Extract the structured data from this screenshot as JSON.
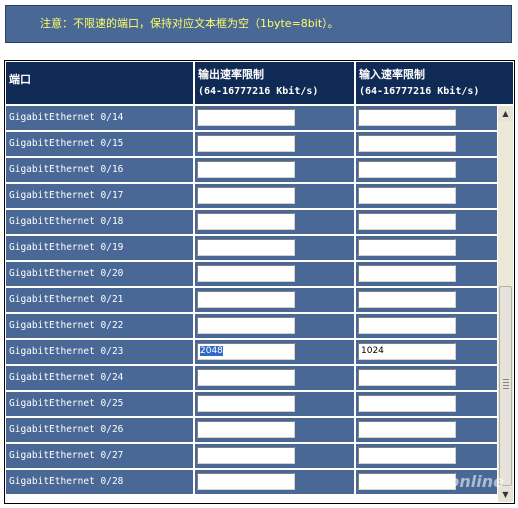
{
  "notice": "注意：不限速的端口，保持对应文本框为空（1byte=8bit）。",
  "columns": {
    "port": "端口",
    "egress_title": "输出速率限制",
    "egress_range": "(64-16777216 Kbit/s)",
    "ingress_title": "输入速率限制",
    "ingress_range": "(64-16777216 Kbit/s)"
  },
  "rows": [
    {
      "port": "GigabitEthernet 0/14",
      "egress": "",
      "ingress": ""
    },
    {
      "port": "GigabitEthernet 0/15",
      "egress": "",
      "ingress": ""
    },
    {
      "port": "GigabitEthernet 0/16",
      "egress": "",
      "ingress": ""
    },
    {
      "port": "GigabitEthernet 0/17",
      "egress": "",
      "ingress": ""
    },
    {
      "port": "GigabitEthernet 0/18",
      "egress": "",
      "ingress": ""
    },
    {
      "port": "GigabitEthernet 0/19",
      "egress": "",
      "ingress": ""
    },
    {
      "port": "GigabitEthernet 0/20",
      "egress": "",
      "ingress": ""
    },
    {
      "port": "GigabitEthernet 0/21",
      "egress": "",
      "ingress": ""
    },
    {
      "port": "GigabitEthernet 0/22",
      "egress": "",
      "ingress": ""
    },
    {
      "port": "GigabitEthernet 0/23",
      "egress": "2048",
      "ingress": "1024"
    },
    {
      "port": "GigabitEthernet 0/24",
      "egress": "",
      "ingress": ""
    },
    {
      "port": "GigabitEthernet 0/25",
      "egress": "",
      "ingress": ""
    },
    {
      "port": "GigabitEthernet 0/26",
      "egress": "",
      "ingress": ""
    },
    {
      "port": "GigabitEthernet 0/27",
      "egress": "",
      "ingress": ""
    },
    {
      "port": "GigabitEthernet 0/28",
      "egress": "",
      "ingress": ""
    }
  ],
  "selected_field": "rows.9.egress",
  "watermark": "PConline",
  "scrollbar": {
    "up_icon": "arrow-up-icon",
    "down_icon": "arrow-down-icon"
  },
  "colors": {
    "header_bg": "#0f2a55",
    "row_bg": "#4a6896",
    "notice_text": "#ffff66",
    "selection": "#316ac5"
  }
}
